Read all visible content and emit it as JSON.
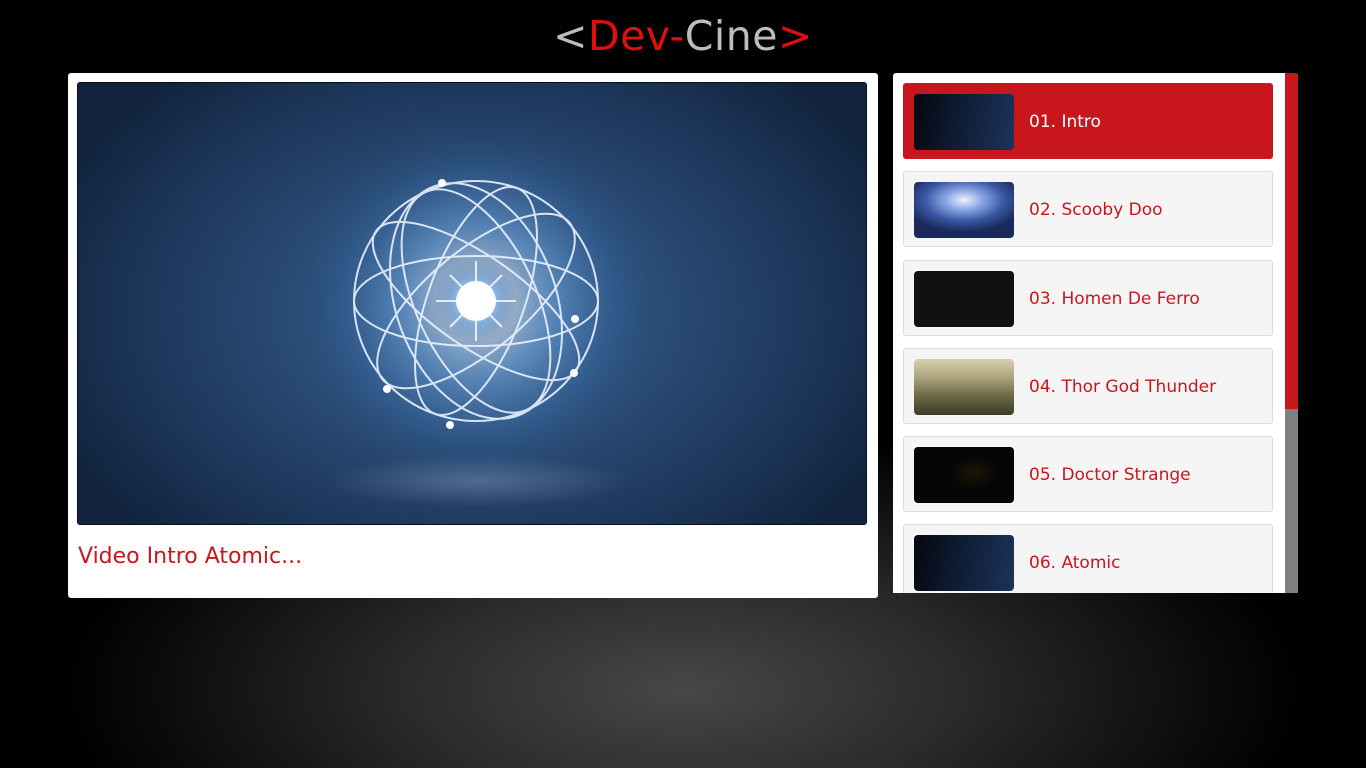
{
  "brand": {
    "open": "<",
    "dev": "Dev-",
    "cine": "Cine",
    "close": ">",
    "colors": {
      "grey": "#bdbdbd",
      "red": "#e00f0f"
    }
  },
  "player": {
    "title": "Video Intro Atomic...",
    "accent": "#c8161d"
  },
  "playlist": {
    "items": [
      {
        "label": "01. Intro",
        "active": true,
        "thumb": "atomic-thumbnail"
      },
      {
        "label": "02. Scooby Doo",
        "active": false,
        "thumb": "scooby-thumbnail"
      },
      {
        "label": "03. Homen De Ferro",
        "active": false,
        "thumb": "ferro-thumbnail"
      },
      {
        "label": "04. Thor God Thunder",
        "active": false,
        "thumb": "thor-thumbnail"
      },
      {
        "label": "05. Doctor Strange",
        "active": false,
        "thumb": "strange-thumbnail"
      },
      {
        "label": "06. Atomic",
        "active": false,
        "thumb": "atomic-thumbnail"
      }
    ]
  }
}
